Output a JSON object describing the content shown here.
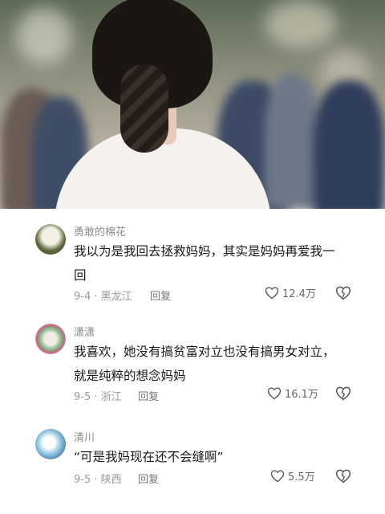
{
  "comments": [
    {
      "username": "勇敢的棉花",
      "text_lines": [
        "我以为是我回去拯救妈妈，其实是妈妈再爱我一",
        "回"
      ],
      "date": "9-4",
      "location": "黑龙江",
      "reply_label": "回复",
      "likes": "12.4万"
    },
    {
      "username": "潇潇",
      "text_lines": [
        "我喜欢，她没有搞贫富对立也没有搞男女对立，",
        "就是纯粹的想念妈妈"
      ],
      "date": "9-5",
      "location": "浙江",
      "reply_label": "回复",
      "likes": "16.1万"
    },
    {
      "username": "清川",
      "text_lines": [
        "“可是我妈现在还不会缝啊”"
      ],
      "date": "9-5",
      "location": "陕西",
      "reply_label": "回复",
      "likes": "5.5万"
    }
  ],
  "icons": {
    "like": "heart-outline-icon",
    "dislike": "broken-heart-icon"
  }
}
